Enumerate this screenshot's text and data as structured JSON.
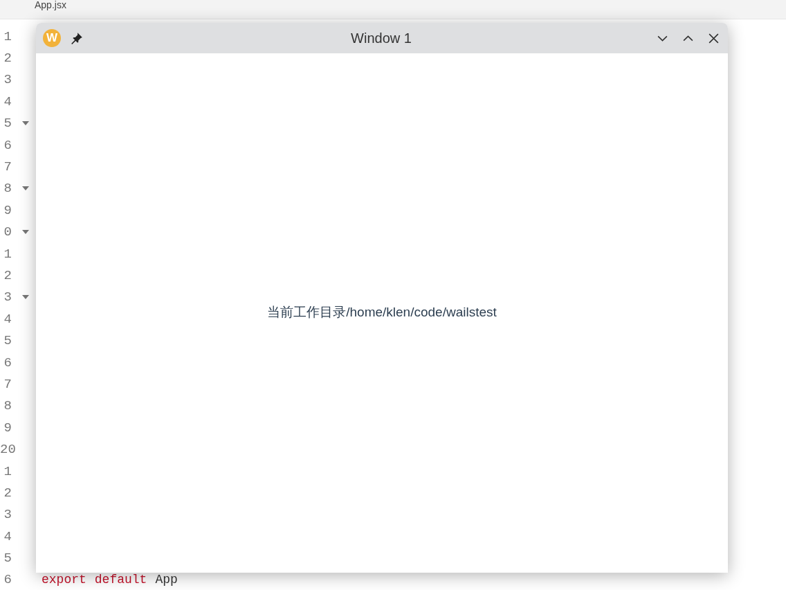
{
  "editor": {
    "tab": {
      "label": "App.jsx"
    },
    "gutter": [
      {
        "number": "1",
        "foldable": false
      },
      {
        "number": "2",
        "foldable": false
      },
      {
        "number": "3",
        "foldable": false
      },
      {
        "number": "4",
        "foldable": false
      },
      {
        "number": "5",
        "foldable": true
      },
      {
        "number": "6",
        "foldable": false
      },
      {
        "number": "7",
        "foldable": false
      },
      {
        "number": "8",
        "foldable": true
      },
      {
        "number": "9",
        "foldable": false
      },
      {
        "number": "0",
        "foldable": true
      },
      {
        "number": "1",
        "foldable": false
      },
      {
        "number": "2",
        "foldable": false
      },
      {
        "number": "3",
        "foldable": true
      },
      {
        "number": "4",
        "foldable": false
      },
      {
        "number": "5",
        "foldable": false
      },
      {
        "number": "6",
        "foldable": false
      },
      {
        "number": "7",
        "foldable": false
      },
      {
        "number": "8",
        "foldable": false
      },
      {
        "number": "9",
        "foldable": false
      },
      {
        "number": "20",
        "foldable": false
      },
      {
        "number": "1",
        "foldable": false
      },
      {
        "number": "2",
        "foldable": false
      },
      {
        "number": "3",
        "foldable": false
      },
      {
        "number": "4",
        "foldable": false
      },
      {
        "number": "5",
        "foldable": false
      },
      {
        "number": "6",
        "foldable": false
      }
    ],
    "visible_code_line": [
      {
        "kind": "keyword",
        "text": "export"
      },
      {
        "kind": "keyword",
        "text": "default"
      },
      {
        "kind": "identifier",
        "text": "App"
      }
    ]
  },
  "window": {
    "logo_letter": "W",
    "title": "Window 1",
    "body_text": "当前工作目录/home/klen/code/wailstest"
  }
}
